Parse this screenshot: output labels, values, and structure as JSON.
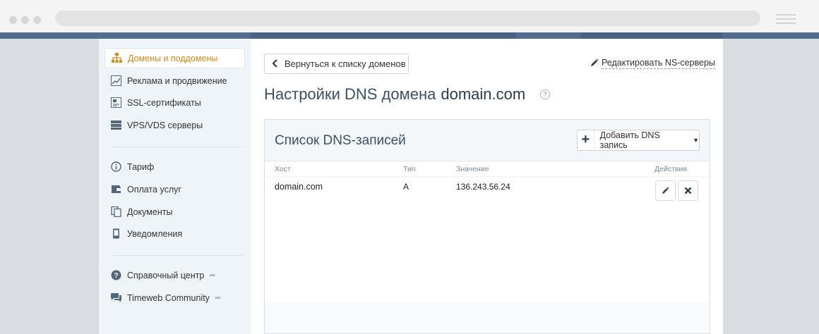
{
  "sidebar": {
    "items": [
      {
        "label": "Домены и поддомены",
        "icon": "sitemap-icon",
        "active": true
      },
      {
        "label": "Реклама и продвижение",
        "icon": "chart-icon"
      },
      {
        "label": "SSL-сертификаты",
        "icon": "certificate-icon"
      },
      {
        "label": "VPS/VDS серверы",
        "icon": "server-icon"
      },
      {
        "label": "Тариф",
        "icon": "info-icon"
      },
      {
        "label": "Оплата услуг",
        "icon": "wallet-icon"
      },
      {
        "label": "Документы",
        "icon": "documents-icon"
      },
      {
        "label": "Уведомления",
        "icon": "phone-icon"
      },
      {
        "label": "Справочный центр",
        "icon": "help-circle-icon",
        "external": true
      },
      {
        "label": "Timeweb Community",
        "icon": "chat-icon",
        "external": true
      }
    ]
  },
  "main": {
    "back_label": "Вернуться к списку доменов",
    "ns_link": "Редактировать NS-серверы",
    "title": "Настройки DNS домена",
    "domain": "domain.com",
    "help_mark": "?"
  },
  "dns": {
    "panel_title": "Список DNS-записей",
    "add_label": "Добавить DNS запись",
    "columns": [
      "Хост",
      "Тип",
      "Значение",
      "Действия"
    ],
    "rows": [
      {
        "host": "domain.com",
        "type": "A",
        "value": "136.243.56.24"
      }
    ]
  },
  "colors": {
    "accent": "#d08b1a",
    "header": "#536c91"
  }
}
